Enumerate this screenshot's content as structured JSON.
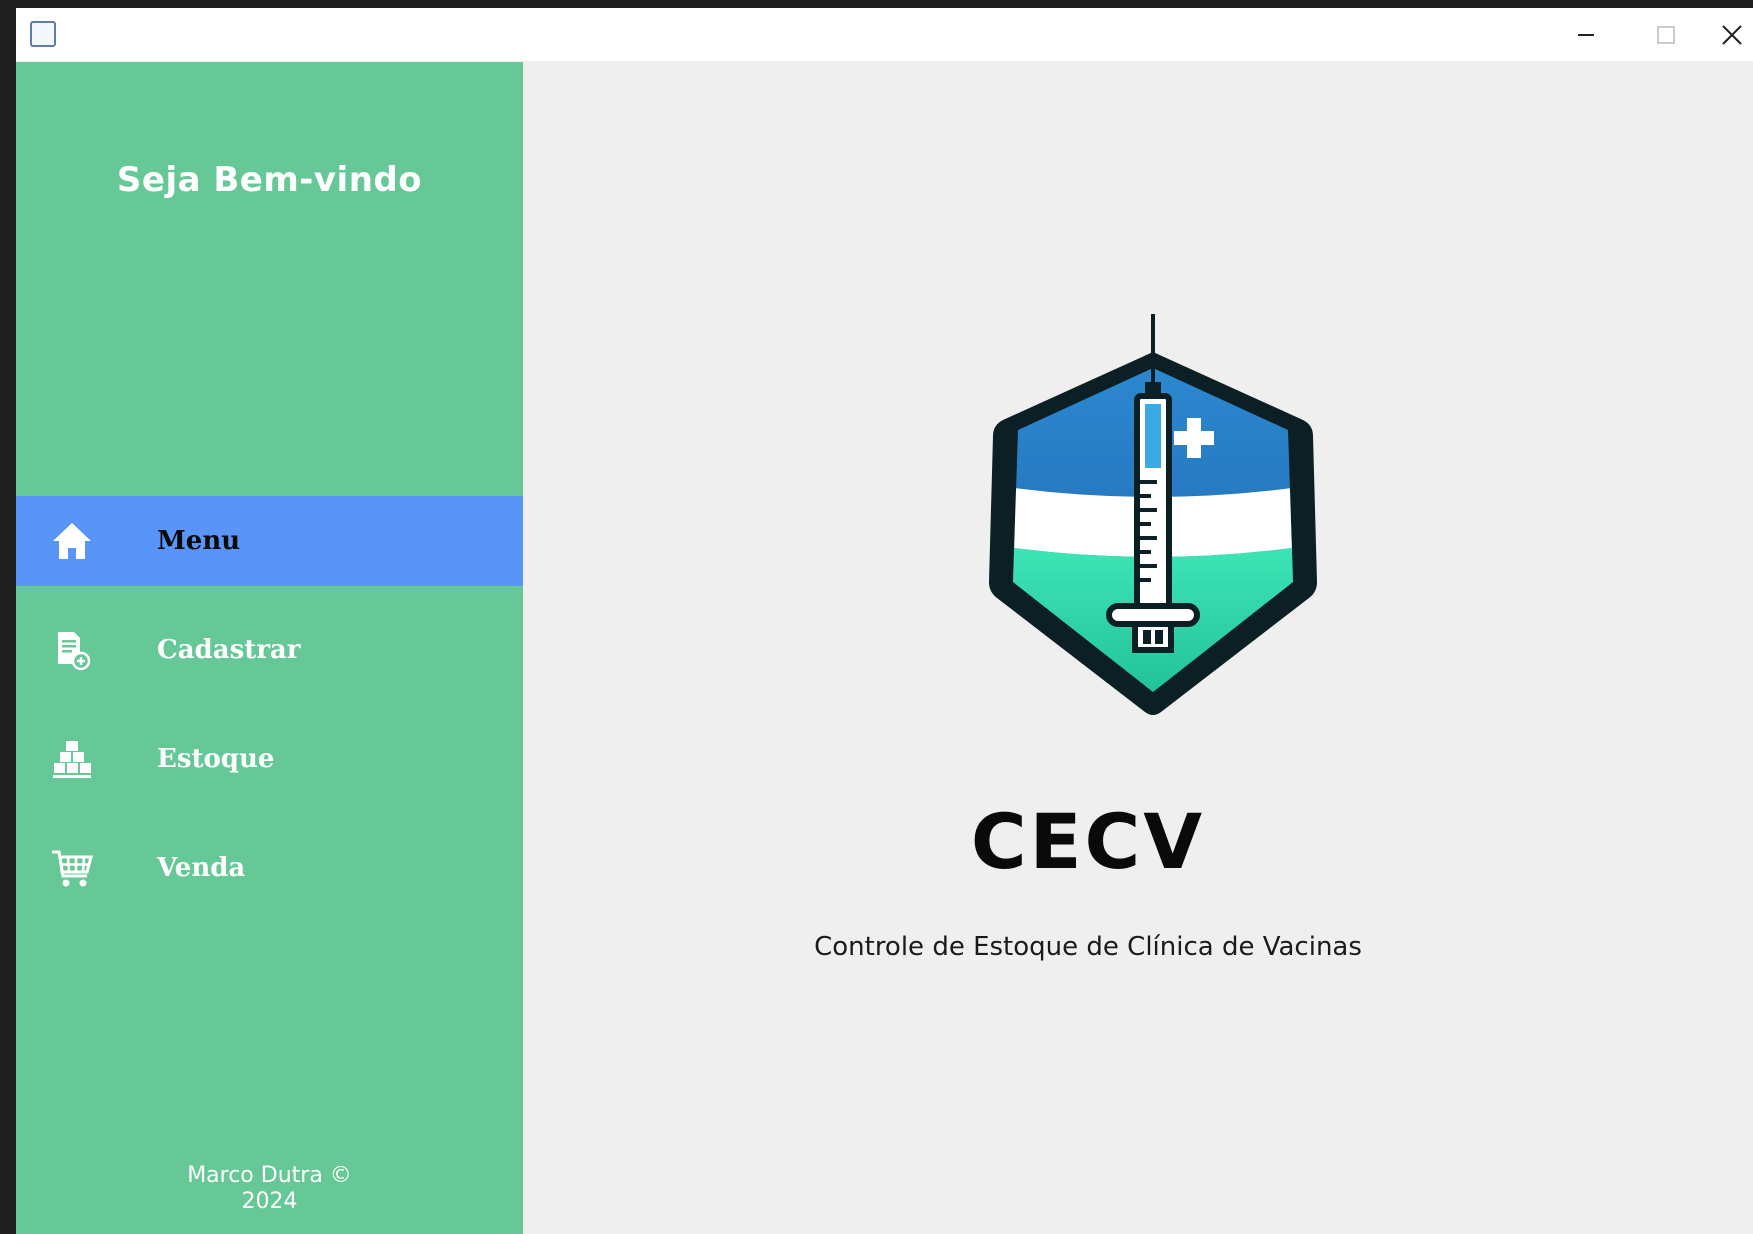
{
  "window": {
    "controls": {
      "minimize": "minimize-icon",
      "maximize": "maximize-icon",
      "close": "close-icon"
    }
  },
  "sidebar": {
    "welcome": "Seja Bem-vindo",
    "items": [
      {
        "label": "Menu",
        "icon": "home-icon",
        "active": true
      },
      {
        "label": "Cadastrar",
        "icon": "register-document-icon",
        "active": false
      },
      {
        "label": "Estoque",
        "icon": "stock-boxes-icon",
        "active": false
      },
      {
        "label": "Venda",
        "icon": "shopping-cart-icon",
        "active": false
      }
    ],
    "footer_line1": "Marco Dutra ©",
    "footer_line2": "2024"
  },
  "main": {
    "brand_title": "CECV",
    "brand_subtitle": "Controle de Estoque de Clínica de Vacinas"
  },
  "colors": {
    "sidebar_bg": "#66c896",
    "active_item_bg": "#5895f7",
    "content_bg": "#efefef"
  }
}
